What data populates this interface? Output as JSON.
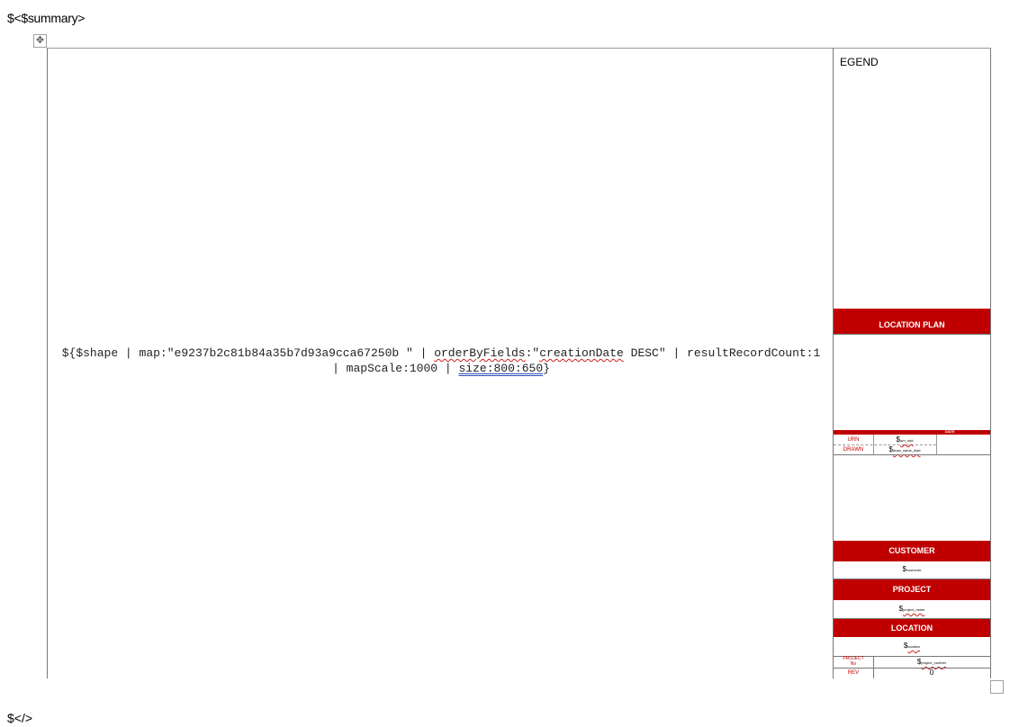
{
  "template": {
    "summary_tag": "$<$summary>",
    "end_tag": "$</>"
  },
  "map_placeholder": {
    "line1_prefix": "${$shape | map:\"e9237b2c81b84a35b7d93a9cca67250b \" | ",
    "order_key": "orderByFields",
    "order_colon": ":\"",
    "order_value": "creationDate",
    "order_rest": " DESC\" | resultRecordCount:1",
    "line2_prefix": "| mapScale:1000 | ",
    "size": "size:800:650",
    "line2_suffix": "}"
  },
  "panel": {
    "legend_label": "EGEND",
    "location_plan": "LOCATION PLAN",
    "date_header": "DATE",
    "urn_label": "URN",
    "urn_value": "$",
    "urn_sub": "urn_sdd",
    "drawn_label": "DRAWN",
    "drawn_value": "$",
    "drawn_sub": "draw_name_dwd",
    "customer": "CUSTOMER",
    "customer_value": "$",
    "customer_sub": "customer",
    "project": "PROJECT",
    "project_value": "$",
    "project_sub": "project_name",
    "location": "LOCATION",
    "location_value": "$",
    "location_sub": "location",
    "project_no_label_1": "PROJECT",
    "project_no_label_2": "No",
    "project_no_value": "$",
    "project_no_sub": "project_number",
    "rev_label": "REV",
    "rev_value": "0"
  }
}
